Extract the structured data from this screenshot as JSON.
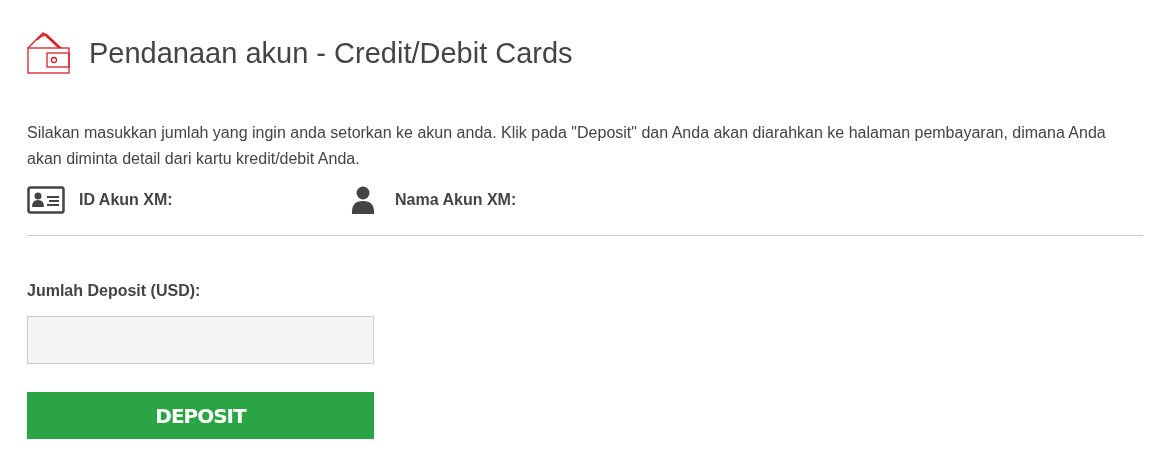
{
  "header": {
    "title": "Pendanaan akun - Credit/Debit Cards"
  },
  "intro": "Silakan masukkan jumlah yang ingin anda setorkan ke akun anda. Klik pada \"Deposit\" dan Anda akan diarahkan ke halaman pembayaran, dimana Anda akan diminta detail dari kartu kredit/debit Anda.",
  "account_info": [
    {
      "kind": "id",
      "label": "ID Akun XM:"
    },
    {
      "kind": "name",
      "label": "Nama Akun XM:"
    }
  ],
  "deposit_form": {
    "label": "Jumlah Deposit (USD):",
    "button": "DEPOSIT"
  }
}
